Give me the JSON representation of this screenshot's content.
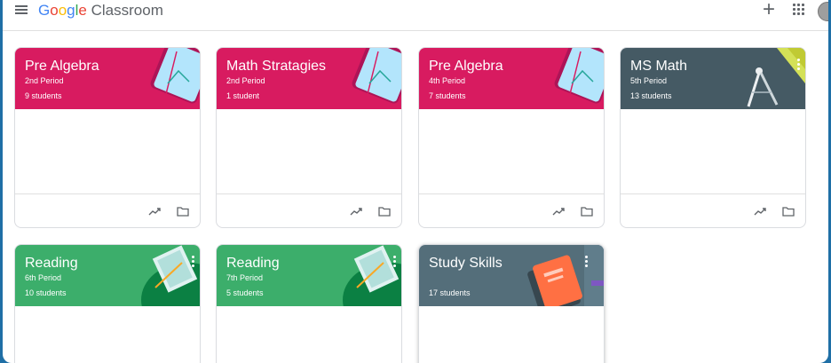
{
  "app": {
    "brand_google": [
      "G",
      "o",
      "o",
      "g",
      "l",
      "e"
    ],
    "brand_product": "Classroom"
  },
  "colors": {
    "pink": "#d81b60",
    "gray": "#455a64",
    "green": "#3cae6b",
    "slate": "#546e7a"
  },
  "classes": [
    {
      "title": "Pre Algebra",
      "section": "2nd Period",
      "students": "9 students",
      "theme": "pink"
    },
    {
      "title": "Math Stratagies",
      "section": "2nd Period",
      "students": "1 student",
      "theme": "pink"
    },
    {
      "title": "Pre Algebra",
      "section": "4th Period",
      "students": "7 students",
      "theme": "pink"
    },
    {
      "title": "MS Math",
      "section": "5th Period",
      "students": "13 students",
      "theme": "gray"
    },
    {
      "title": "Reading",
      "section": "6th Period",
      "students": "10 students",
      "theme": "green"
    },
    {
      "title": "Reading",
      "section": "7th Period",
      "students": "5 students",
      "theme": "green"
    },
    {
      "title": "Study Skills",
      "section": "",
      "students": "17 students",
      "theme": "slate"
    }
  ]
}
